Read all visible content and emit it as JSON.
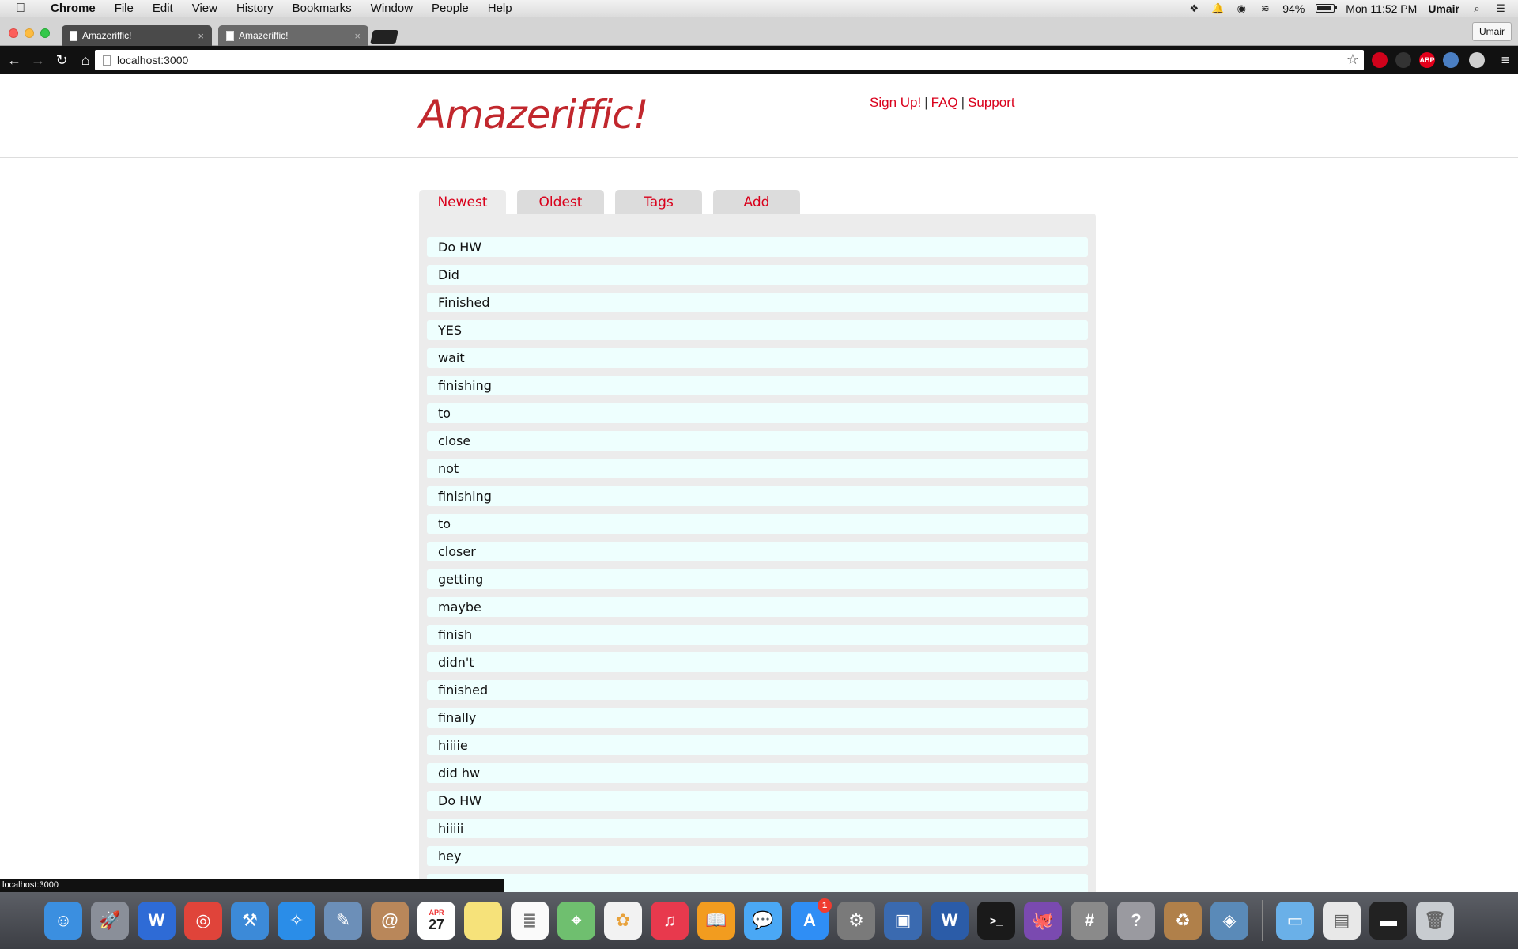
{
  "menubar": {
    "apple": "",
    "items": [
      "Chrome",
      "File",
      "Edit",
      "View",
      "History",
      "Bookmarks",
      "Window",
      "People",
      "Help"
    ],
    "battery": "94%",
    "clock": "Mon 11:52 PM",
    "user": "Umair"
  },
  "browser": {
    "tabs": [
      {
        "title": "Amazeriffic!",
        "close": "×"
      },
      {
        "title": "Amazeriffic!",
        "close": "×"
      }
    ],
    "profile_button": "Umair",
    "url": "localhost:3000",
    "star": "☆",
    "status_url": "localhost:3000",
    "extensions": [
      {
        "name": "adblock-icon",
        "color": "#d0021b",
        "label": ""
      },
      {
        "name": "flash-icon",
        "color": "#333333",
        "label": ""
      },
      {
        "name": "abp-icon",
        "color": "#e3001b",
        "label": "ABP"
      },
      {
        "name": "globe-icon",
        "color": "#4a7ec2",
        "label": ""
      },
      {
        "name": "evernote-icon",
        "color": "#cfcfcf",
        "label": ""
      }
    ]
  },
  "site": {
    "logo": "Amazeriffic!",
    "links": {
      "signup": "Sign Up!",
      "faq": "FAQ",
      "support": "Support",
      "sep": "|"
    },
    "tabs": [
      "Newest",
      "Oldest",
      "Tags",
      "Add"
    ],
    "todos": [
      "Do HW",
      "Did",
      "Finished",
      "YES",
      "wait",
      "finishing",
      "to",
      "close",
      "not",
      "finishing",
      "to",
      "closer",
      "getting",
      "maybe",
      "finish",
      "didn't",
      "finished",
      "finally",
      "hiiiie",
      "did hw",
      "Do HW",
      "hiiiii",
      "hey",
      ""
    ]
  },
  "dock": {
    "app_store_badge": "1",
    "calendar_month": "APR",
    "calendar_day": "27",
    "icons": [
      {
        "name": "finder-icon",
        "color": "#3b8fe0"
      },
      {
        "name": "launchpad-icon",
        "color": "#8a8f99"
      },
      {
        "name": "wunderlist-icon",
        "color": "#2e6bd6"
      },
      {
        "name": "chrome-icon",
        "color": "#e0443a"
      },
      {
        "name": "xcode-icon",
        "color": "#3c8ad8"
      },
      {
        "name": "safari-icon",
        "color": "#2a8de8"
      },
      {
        "name": "preview-icon",
        "color": "#6c8fb8"
      },
      {
        "name": "contacts-icon",
        "color": "#b9875a"
      },
      {
        "name": "calendar-icon",
        "color": "#ffffff"
      },
      {
        "name": "notes-icon",
        "color": "#f6e27a"
      },
      {
        "name": "reminders-icon",
        "color": "#fafafa"
      },
      {
        "name": "maps-icon",
        "color": "#6fbf6f"
      },
      {
        "name": "photos-icon",
        "color": "#f2f2f2"
      },
      {
        "name": "itunes-icon",
        "color": "#e8394d"
      },
      {
        "name": "ibooks-icon",
        "color": "#f29c1f"
      },
      {
        "name": "messages-icon",
        "color": "#4aa8f5"
      },
      {
        "name": "app-store-icon",
        "color": "#2f8ef5"
      },
      {
        "name": "system-preferences-icon",
        "color": "#7a7a7a"
      },
      {
        "name": "virtualbox-icon",
        "color": "#3a6ab0"
      },
      {
        "name": "word-icon",
        "color": "#2b5ca8"
      },
      {
        "name": "terminal-icon",
        "color": "#1a1a1a"
      },
      {
        "name": "github-icon",
        "color": "#7a4ab0"
      },
      {
        "name": "calculator-icon",
        "color": "#8a8a8a"
      },
      {
        "name": "help-icon",
        "color": "#9a9aa0"
      },
      {
        "name": "archive-utility-icon",
        "color": "#b0804a"
      },
      {
        "name": "photo-browser-icon",
        "color": "#5a8ab8"
      },
      {
        "name": "downloads-folder-icon",
        "color": "#6ab0e8"
      },
      {
        "name": "documents-icon",
        "color": "#e8e8e8"
      },
      {
        "name": "recent-window-icon",
        "color": "#222222"
      },
      {
        "name": "trash-icon",
        "color": "#c8ccd0"
      }
    ]
  }
}
